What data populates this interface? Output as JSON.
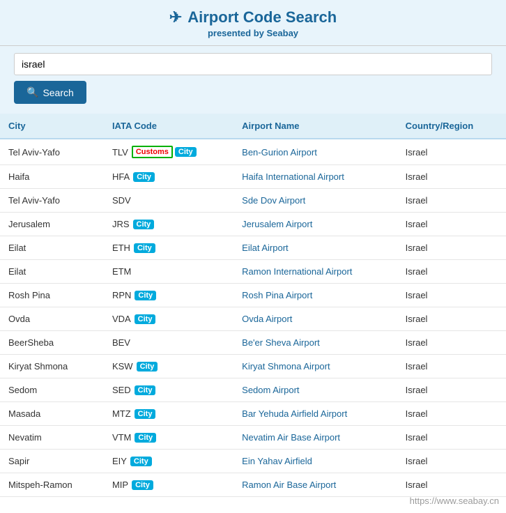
{
  "header": {
    "title": "Airport Code Search",
    "subtitle": "presented by",
    "brand": "Seabay",
    "plane_icon": "✈"
  },
  "search": {
    "placeholder": "israel",
    "value": "israel",
    "button_label": "Search"
  },
  "table": {
    "columns": [
      "City",
      "IATA Code",
      "Airport Name",
      "Country/Region"
    ],
    "rows": [
      {
        "city": "Tel Aviv-Yafo",
        "iata": "TLV",
        "badges": [
          "Customs",
          "City"
        ],
        "airport": "Ben-Gurion Airport",
        "country": "Israel"
      },
      {
        "city": "Haifa",
        "iata": "HFA",
        "badges": [
          "City"
        ],
        "airport": "Haifa International Airport",
        "country": "Israel"
      },
      {
        "city": "Tel Aviv-Yafo",
        "iata": "SDV",
        "badges": [],
        "airport": "Sde Dov Airport",
        "country": "Israel"
      },
      {
        "city": "Jerusalem",
        "iata": "JRS",
        "badges": [
          "City"
        ],
        "airport": "Jerusalem Airport",
        "country": "Israel"
      },
      {
        "city": "Eilat",
        "iata": "ETH",
        "badges": [
          "City"
        ],
        "airport": "Eilat Airport",
        "country": "Israel"
      },
      {
        "city": "Eilat",
        "iata": "ETM",
        "badges": [],
        "airport": "Ramon International Airport",
        "country": "Israel"
      },
      {
        "city": "Rosh Pina",
        "iata": "RPN",
        "badges": [
          "City"
        ],
        "airport": "Rosh Pina Airport",
        "country": "Israel"
      },
      {
        "city": "Ovda",
        "iata": "VDA",
        "badges": [
          "City"
        ],
        "airport": "Ovda Airport",
        "country": "Israel"
      },
      {
        "city": "BeerSheba",
        "iata": "BEV",
        "badges": [],
        "airport": "Be'er Sheva Airport",
        "country": "Israel"
      },
      {
        "city": "Kiryat Shmona",
        "iata": "KSW",
        "badges": [
          "City"
        ],
        "airport": "Kiryat Shmona Airport",
        "country": "Israel"
      },
      {
        "city": "Sedom",
        "iata": "SED",
        "badges": [
          "City"
        ],
        "airport": "Sedom Airport",
        "country": "Israel"
      },
      {
        "city": "Masada",
        "iata": "MTZ",
        "badges": [
          "City"
        ],
        "airport": "Bar Yehuda Airfield Airport",
        "country": "Israel"
      },
      {
        "city": "Nevatim",
        "iata": "VTM",
        "badges": [
          "City"
        ],
        "airport": "Nevatim Air Base Airport",
        "country": "Israel"
      },
      {
        "city": "Sapir",
        "iata": "EIY",
        "badges": [
          "City"
        ],
        "airport": "Ein Yahav Airfield",
        "country": "Israel"
      },
      {
        "city": "Mitspeh-Ramon",
        "iata": "MIP",
        "badges": [
          "City"
        ],
        "airport": "Ramon Air Base Airport",
        "country": "Israel"
      }
    ]
  },
  "watermark": "https://www.seabay.cn"
}
